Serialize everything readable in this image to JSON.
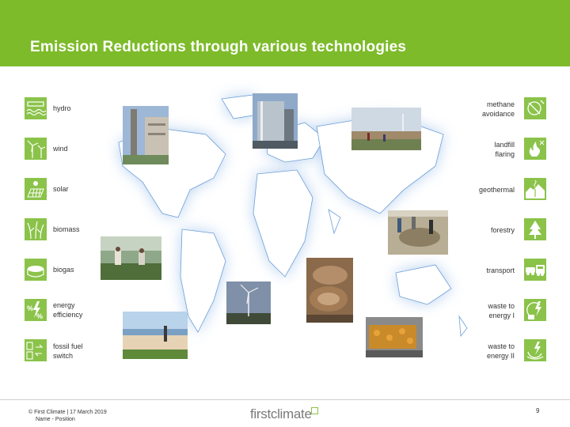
{
  "slide": {
    "title": "Emission Reductions through various technologies"
  },
  "technologies_left": [
    {
      "label": "hydro",
      "icon": "hydro-icon"
    },
    {
      "label": "wind",
      "icon": "wind-turbine-icon"
    },
    {
      "label": "solar",
      "icon": "solar-panel-icon"
    },
    {
      "label": "biomass",
      "icon": "biomass-icon"
    },
    {
      "label": "biogas",
      "icon": "biogas-icon"
    },
    {
      "label": "energy\nefficiency",
      "icon": "energy-efficiency-icon"
    },
    {
      "label": "fossil fuel\nswitch",
      "icon": "fossil-fuel-switch-icon"
    }
  ],
  "technologies_right": [
    {
      "label": "methane\navoidance",
      "icon": "methane-avoidance-icon"
    },
    {
      "label": "landfill\nflaring",
      "icon": "landfill-flaring-icon"
    },
    {
      "label": "geothermal",
      "icon": "geothermal-icon"
    },
    {
      "label": "forestry",
      "icon": "forestry-icon"
    },
    {
      "label": "transport",
      "icon": "transport-icon"
    },
    {
      "label": "waste to\nenergy I",
      "icon": "waste-to-energy-icon"
    },
    {
      "label": "waste to\nenergy II",
      "icon": "waste-to-energy-ii-icon"
    }
  ],
  "colors": {
    "header_green": "#7dbb2a",
    "tile_green": "#8bc34a"
  },
  "footer": {
    "copyright": "© First Climate | 17 March 2019",
    "subline": "Name - Position",
    "logo": "firstclimate",
    "page": "9"
  }
}
